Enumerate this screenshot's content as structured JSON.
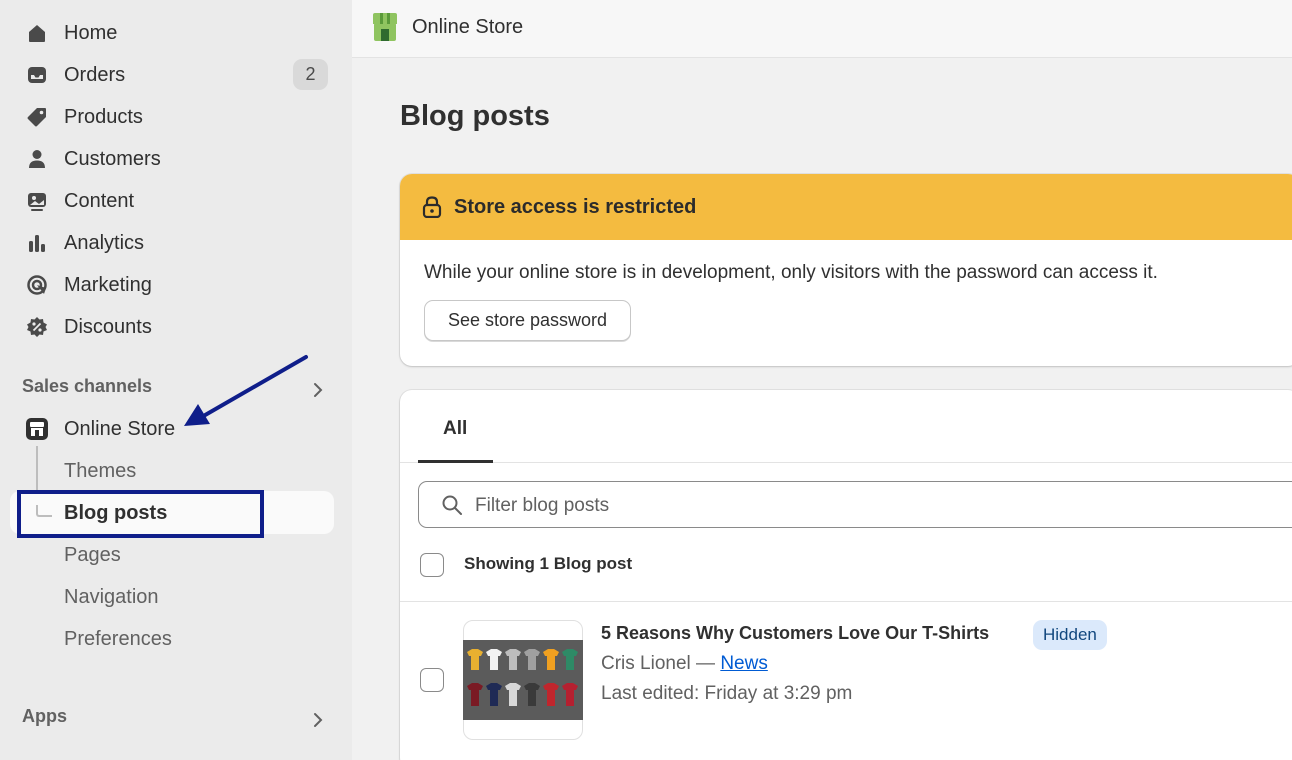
{
  "sidebar": {
    "items": [
      {
        "label": "Home",
        "icon": "home-icon"
      },
      {
        "label": "Orders",
        "icon": "inbox-icon",
        "badge": "2"
      },
      {
        "label": "Products",
        "icon": "tag-icon"
      },
      {
        "label": "Customers",
        "icon": "person-icon"
      },
      {
        "label": "Content",
        "icon": "image-icon"
      },
      {
        "label": "Analytics",
        "icon": "bar-chart-icon"
      },
      {
        "label": "Marketing",
        "icon": "target-icon"
      },
      {
        "label": "Discounts",
        "icon": "discount-icon"
      }
    ],
    "sales_channels": {
      "heading": "Sales channels",
      "online_store": "Online Store",
      "sub_items": [
        "Themes",
        "Blog posts",
        "Pages",
        "Navigation",
        "Preferences"
      ],
      "active": "Blog posts"
    },
    "apps_heading": "Apps"
  },
  "topbar": {
    "title": "Online Store"
  },
  "page": {
    "title": "Blog posts"
  },
  "banner": {
    "heading": "Store access is restricted",
    "text": "While your online store is in development, only visitors with the password can access it.",
    "button": "See store password",
    "color": "#f4bb40"
  },
  "list": {
    "tab": "All",
    "filter_placeholder": "Filter blog posts",
    "showing": "Showing 1 Blog post",
    "posts": [
      {
        "title": "5 Reasons Why Customers Love Our T-Shirts",
        "status": "Hidden",
        "author": "Cris Lionel",
        "separator": " — ",
        "blog": "News",
        "edited": "Last edited: Friday at 3:29 pm"
      }
    ]
  },
  "annotation_colors": {
    "highlight": "#0f1e8a",
    "arrow": "#0f1e8a"
  }
}
